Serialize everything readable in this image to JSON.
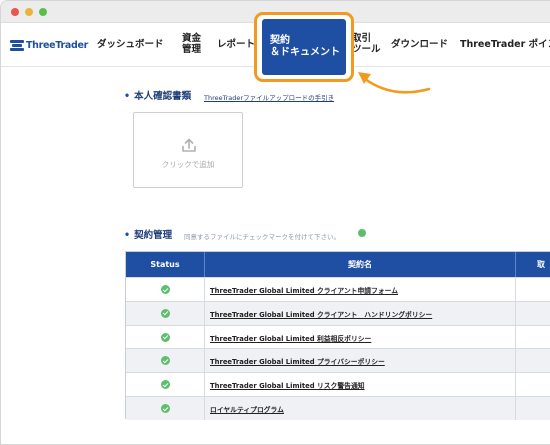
{
  "nav": {
    "brand": "ThreeTrader",
    "items": [
      {
        "id": "dashboard",
        "label": "ダッシュボード"
      },
      {
        "id": "funds",
        "label_line1": "資金",
        "label_line2": "管理"
      },
      {
        "id": "reports",
        "label": "レポート"
      },
      {
        "id": "contracts",
        "label_line1": "契約",
        "label_line2": "＆ドキュメント"
      },
      {
        "id": "trading-tools",
        "label_line1": "取引",
        "label_line2": "ツール"
      },
      {
        "id": "downloads",
        "label": "ダウンロード"
      },
      {
        "id": "points",
        "label": "ThreeTrader ポイント"
      }
    ]
  },
  "identity": {
    "title": "本人確認書類",
    "help_link": "ThreeTraderファイルアップロードの手引き",
    "upload_label": "クリックで追加"
  },
  "contracts": {
    "title": "契約管理",
    "hint": "同意するファイルにチェックマークを付けて下さい。",
    "columns": {
      "status": "Status",
      "name": "契約名",
      "extra": "取"
    },
    "rows": [
      {
        "name": "ThreeTrader Global Limited クライアント申請フォーム"
      },
      {
        "name": "ThreeTrader Global Limited クライアント　ハンドリングポリシー"
      },
      {
        "name": "ThreeTrader Global Limited 利益相反ポリシー"
      },
      {
        "name": "ThreeTrader Global Limited プライバシーポリシー"
      },
      {
        "name": "ThreeTrader Global Limited リスク警告通知"
      },
      {
        "name": "ロイヤルティプログラム"
      }
    ]
  },
  "colors": {
    "brand_blue": "#1f4fa3",
    "highlight_orange": "#f39a1e",
    "check_green": "#5bbf6b"
  }
}
